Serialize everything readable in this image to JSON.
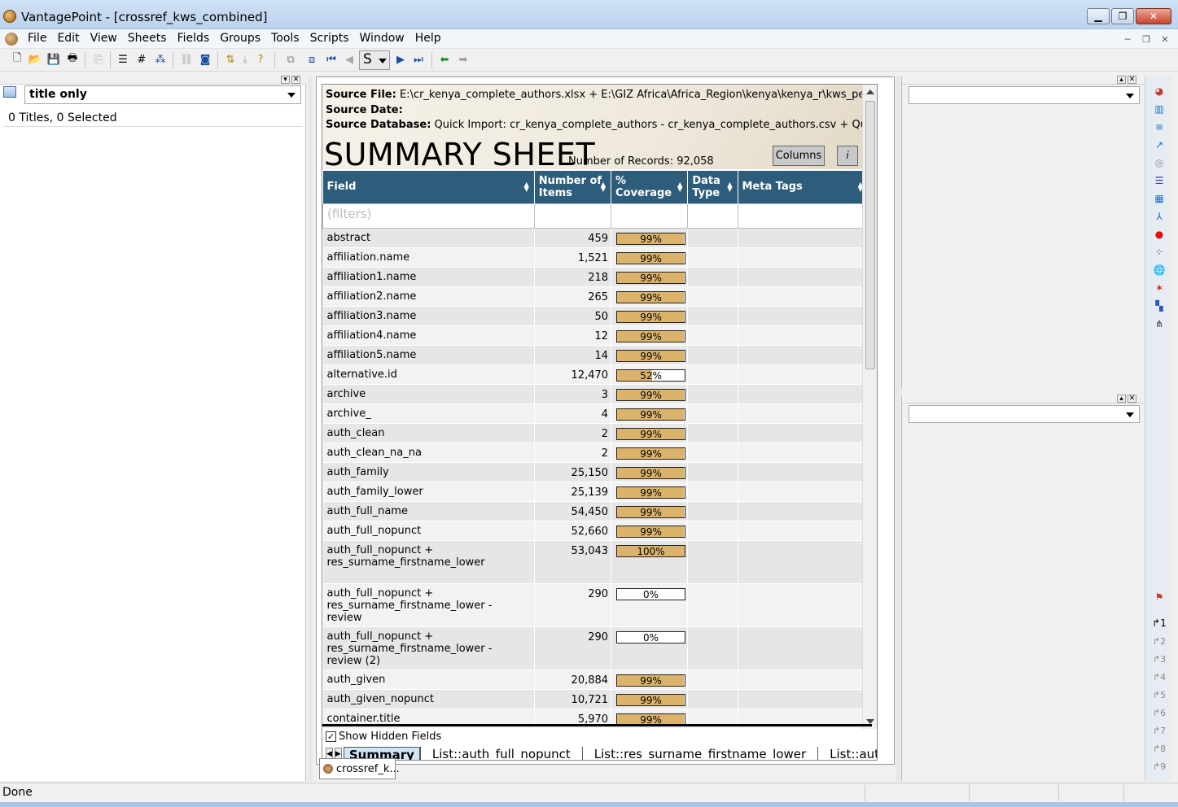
{
  "window": {
    "title": "VantagePoint - [crossref_kws_combined]",
    "minimize_label": "▁",
    "maximize_label": "❐",
    "close_label": "✕"
  },
  "menu": [
    "File",
    "Edit",
    "View",
    "Sheets",
    "Fields",
    "Groups",
    "Tools",
    "Scripts",
    "Window",
    "Help"
  ],
  "toolbar": {
    "combo_value": "S"
  },
  "left_pane": {
    "select_value": "title only",
    "count_text": "0 Titles, 0 Selected"
  },
  "summary": {
    "source_file_label": "Source File:",
    "source_file_value": "E:\\cr_kenya_complete_authors.xlsx + E:\\GIZ Africa\\Africa_Region\\kenya\\kenya_r\\kws_perm...",
    "source_date_label": "Source Date:",
    "source_db_label": "Source Database:",
    "source_db_value": "Quick Import: cr_kenya_complete_authors - cr_kenya_complete_authors.csv + Quick I...",
    "title": "SUMMARY SHEET",
    "records_text": "Number of Records: 92,058",
    "columns_button": "Columns",
    "info_button": "i",
    "columns": [
      "Field",
      "Number of Items",
      "% Coverage",
      "Data Type",
      "Meta Tags"
    ],
    "filter_placeholder": "(filters)",
    "rows": [
      {
        "field": "abstract",
        "items": "459",
        "coverage": "99%",
        "pct": 99
      },
      {
        "field": "affiliation.name",
        "items": "1,521",
        "coverage": "99%",
        "pct": 99
      },
      {
        "field": "affiliation1.name",
        "items": "218",
        "coverage": "99%",
        "pct": 99
      },
      {
        "field": "affiliation2.name",
        "items": "265",
        "coverage": "99%",
        "pct": 99
      },
      {
        "field": "affiliation3.name",
        "items": "50",
        "coverage": "99%",
        "pct": 99
      },
      {
        "field": "affiliation4.name",
        "items": "12",
        "coverage": "99%",
        "pct": 99
      },
      {
        "field": "affiliation5.name",
        "items": "14",
        "coverage": "99%",
        "pct": 99
      },
      {
        "field": "alternative.id",
        "items": "12,470",
        "coverage": "52%",
        "pct": 52
      },
      {
        "field": "archive",
        "items": "3",
        "coverage": "99%",
        "pct": 99
      },
      {
        "field": "archive_",
        "items": "4",
        "coverage": "99%",
        "pct": 99
      },
      {
        "field": "auth_clean",
        "items": "2",
        "coverage": "99%",
        "pct": 99
      },
      {
        "field": "auth_clean_na_na",
        "items": "2",
        "coverage": "99%",
        "pct": 99
      },
      {
        "field": "auth_family",
        "items": "25,150",
        "coverage": "99%",
        "pct": 99
      },
      {
        "field": "auth_family_lower",
        "items": "25,139",
        "coverage": "99%",
        "pct": 99
      },
      {
        "field": "auth_full_name",
        "items": "54,450",
        "coverage": "99%",
        "pct": 99
      },
      {
        "field": "auth_full_nopunct",
        "items": "52,660",
        "coverage": "99%",
        "pct": 99
      },
      {
        "field": "auth_full_nopunct + res_surname_firstname_lower",
        "items": "53,043",
        "coverage": "100%",
        "pct": 100
      },
      {
        "field": "auth_full_nopunct + res_surname_firstname_lower - review",
        "items": "290",
        "coverage": "0%",
        "pct": 0
      },
      {
        "field": "auth_full_nopunct + res_surname_firstname_lower - review (2)",
        "items": "290",
        "coverage": "0%",
        "pct": 0
      },
      {
        "field": "auth_given",
        "items": "20,884",
        "coverage": "99%",
        "pct": 99
      },
      {
        "field": "auth_given_nopunct",
        "items": "10,721",
        "coverage": "99%",
        "pct": 99
      },
      {
        "field": "container.title",
        "items": "5,970",
        "coverage": "99%",
        "pct": 99
      }
    ],
    "show_hidden_label": "Show Hidden Fields",
    "sheet_tabs": [
      "Summary",
      "List::auth_full_nopunct",
      "List::res_surname_firstname_lower",
      "List::autl"
    ],
    "doc_tab": "crossref_k..."
  },
  "status": {
    "text": "Done"
  }
}
